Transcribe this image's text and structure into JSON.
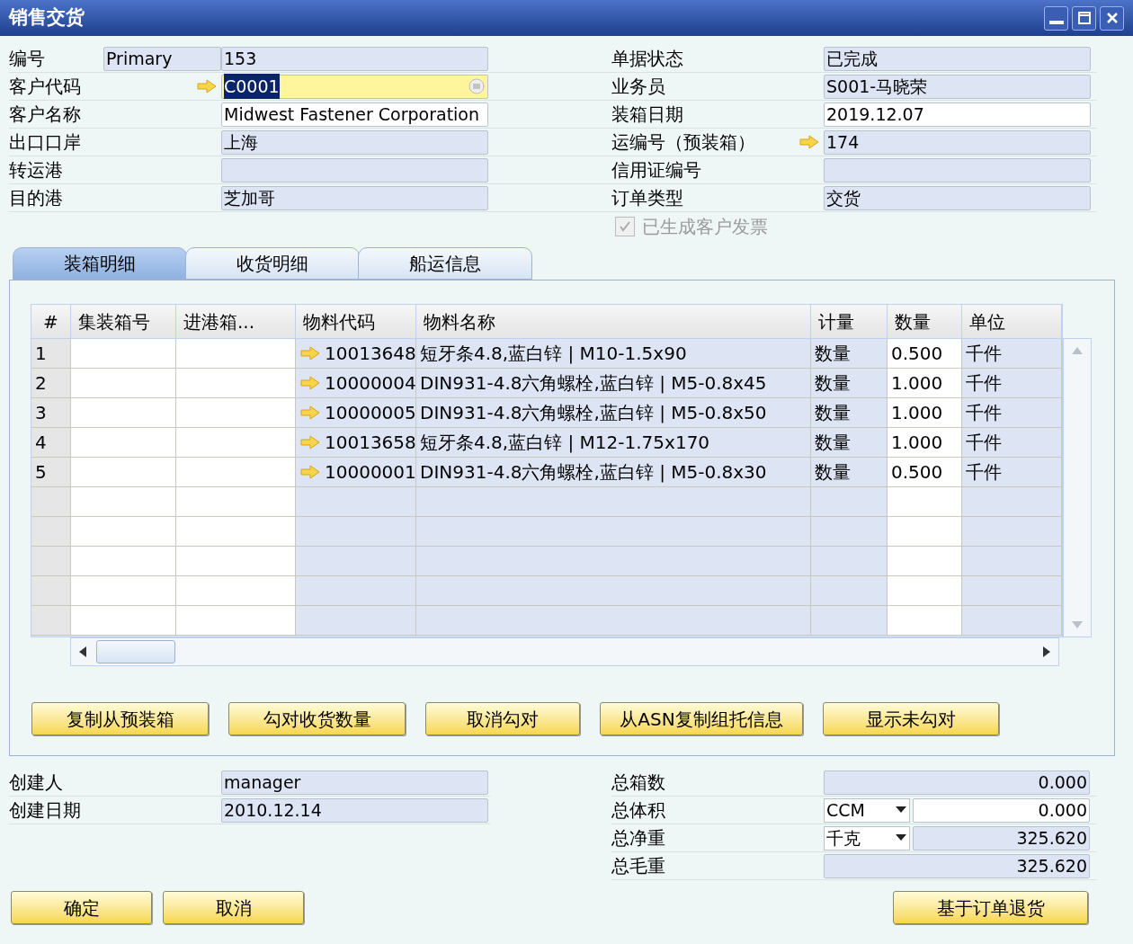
{
  "window": {
    "title": "销售交货"
  },
  "header_left": [
    {
      "label": "编号",
      "series": "Primary",
      "value": "153",
      "kind": "readonly"
    },
    {
      "label": "客户代码",
      "value": "C0001",
      "kind": "focused",
      "link": true
    },
    {
      "label": "客户名称",
      "value": "Midwest Fastener Corporation",
      "kind": "editable",
      "link": false
    },
    {
      "label": "出口口岸",
      "value": "上海",
      "kind": "readonly",
      "link": false
    },
    {
      "label": "转运港",
      "kind": "readonly",
      "link": false
    },
    {
      "label": "目的港",
      "value": "芝加哥",
      "kind": "readonly",
      "link": false
    }
  ],
  "header_right": [
    {
      "label": "单据状态",
      "value": "已完成",
      "kind": "readonly",
      "link": false
    },
    {
      "label": "业务员",
      "value": "S001-马晓荣",
      "kind": "readonly",
      "link": false
    },
    {
      "label": "装箱日期",
      "value": "2019.12.07",
      "kind": "editable",
      "link": false
    },
    {
      "label": "运编号（预装箱）",
      "value": "174",
      "kind": "readonly",
      "link": true
    },
    {
      "label": "信用证编号",
      "kind": "readonly",
      "link": false
    },
    {
      "label": "订单类型",
      "value": "交货",
      "kind": "readonly",
      "link": false
    }
  ],
  "invoice_checkbox": {
    "label": "已生成客户发票",
    "checked": true,
    "disabled": true
  },
  "tabs": [
    {
      "label": "装箱明细",
      "selected": true
    },
    {
      "label": "收货明细",
      "selected": false
    },
    {
      "label": "船运信息",
      "selected": false
    }
  ],
  "table": {
    "columns": [
      "#",
      "集装箱号",
      "进港箱...",
      "物料代码",
      "物料名称",
      "计量",
      "数量",
      "单位"
    ],
    "rows": [
      {
        "num": "1",
        "code": "10013648",
        "name": "短牙条4.8,蓝白锌 | M10-1.5x90",
        "measure": "数量",
        "qty": "0.500",
        "unit": "千件"
      },
      {
        "num": "2",
        "code": "10000004",
        "name": "DIN931-4.8六角螺栓,蓝白锌 | M5-0.8x45",
        "measure": "数量",
        "qty": "1.000",
        "unit": "千件"
      },
      {
        "num": "3",
        "code": "10000005",
        "name": "DIN931-4.8六角螺栓,蓝白锌 | M5-0.8x50",
        "measure": "数量",
        "qty": "1.000",
        "unit": "千件"
      },
      {
        "num": "4",
        "code": "10013658",
        "name": "短牙条4.8,蓝白锌 | M12-1.75x170",
        "measure": "数量",
        "qty": "1.000",
        "unit": "千件"
      },
      {
        "num": "5",
        "code": "10000001",
        "name": "DIN931-4.8六角螺栓,蓝白锌 | M5-0.8x30",
        "measure": "数量",
        "qty": "0.500",
        "unit": "千件"
      }
    ]
  },
  "panel_buttons": [
    "复制从预装箱",
    "勾对收货数量",
    "取消勾对",
    "从ASN复制组托信息",
    "显示未勾对"
  ],
  "footer_left": [
    {
      "label": "创建人",
      "value": "manager"
    },
    {
      "label": "创建日期",
      "value": "2010.12.14"
    }
  ],
  "footer_right": [
    {
      "label": "总箱数",
      "value": "0.000",
      "kind": "readonly"
    },
    {
      "label": "总体积",
      "unit": "CCM",
      "value": "0.000",
      "kind": "editable"
    },
    {
      "label": "总净重",
      "unit": "千克",
      "value": "325.620",
      "kind": "readonly"
    },
    {
      "label": "总毛重",
      "value": "325.620",
      "kind": "readonly"
    }
  ],
  "buttons_left": [
    "确定",
    "取消"
  ],
  "buttons_right": [
    "基于订单退货"
  ]
}
